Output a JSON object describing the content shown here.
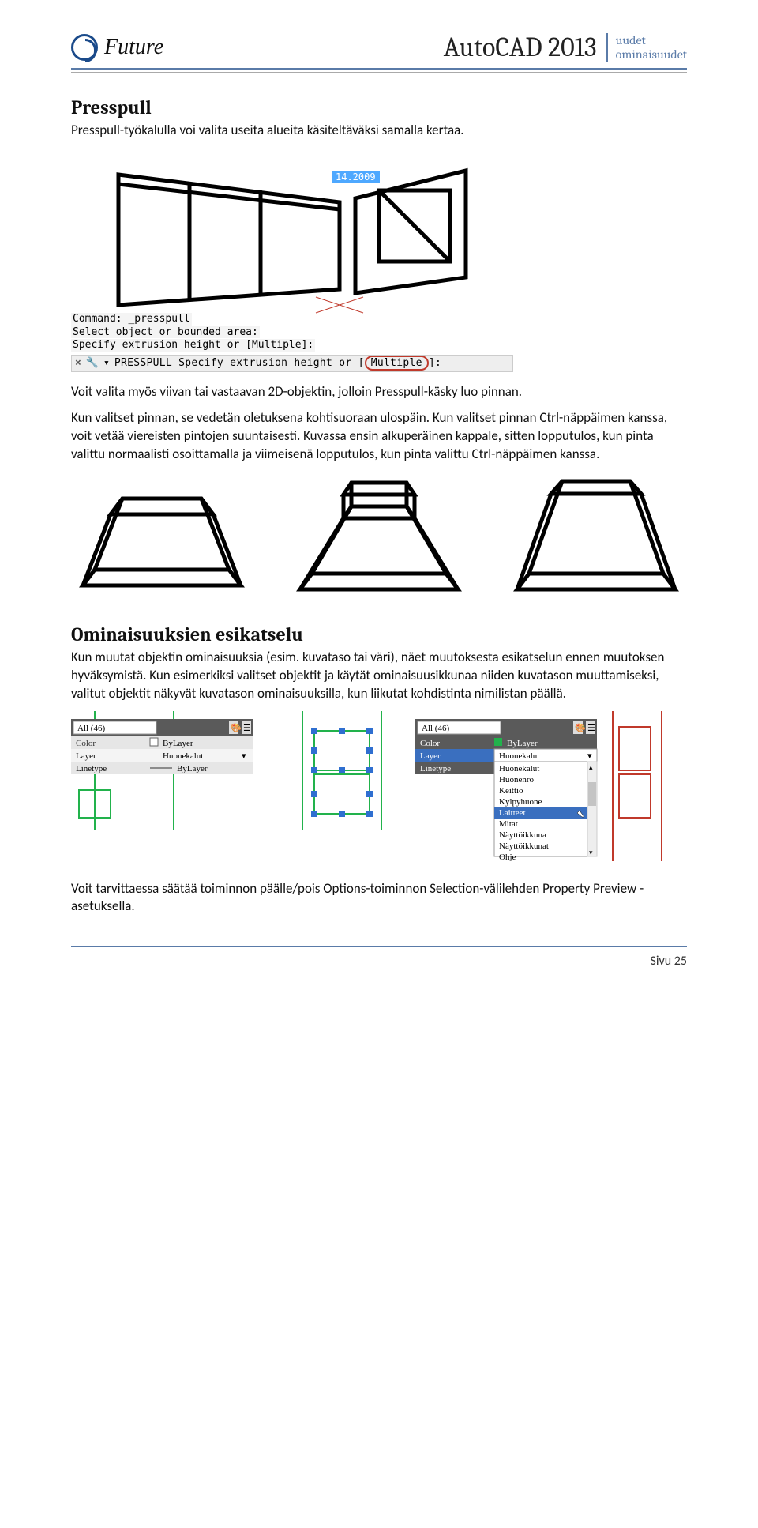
{
  "header": {
    "logo_text": "Future",
    "title_main": "AutoCAD 2013",
    "title_side_line1": "uudet",
    "title_side_line2": "ominaisuudet"
  },
  "section1": {
    "heading": "Presspull",
    "p1": "Presspull-työkalulla voi valita useita alueita käsiteltäväksi samalla kertaa."
  },
  "fig1": {
    "dim": "14.2009",
    "cmd_line1": "Command: _presspull",
    "cmd_line2": "Select object or bounded area:",
    "cmd_line3": "Specify extrusion height or [Multiple]:",
    "bar_label": "PRESSPULL Specify extrusion height or [",
    "bar_opt": "Multiple",
    "bar_end": "]:"
  },
  "section1b": {
    "p2": "Voit valita myös viivan tai vastaavan 2D-objektin, jolloin Presspull-käsky luo pinnan.",
    "p3": "Kun valitset pinnan, se vedetän oletuksena kohtisuoraan ulospäin. Kun valitset pinnan Ctrl-näppäimen kanssa, voit vetää viereisten pintojen suuntaisesti. Kuvassa ensin alkuperäinen kappale, sitten lopputulos, kun pinta valittu normaalisti osoittamalla ja viimeisenä lopputulos, kun pinta valittu Ctrl-näppäimen kanssa."
  },
  "section2": {
    "heading": "Ominaisuuksien esikatselu",
    "p1": "Kun muutat objektin ominaisuuksia (esim. kuvataso tai väri), näet muutoksesta esikatselun ennen muutoksen hyväksymistä. Kun esimerkiksi valitset objektit ja käytät ominaisuusikkunaa niiden kuvatason muuttamiseksi, valitut objektit näkyvät kuvatason ominaisuuksilla, kun liikutat kohdistinta nimilistan päällä."
  },
  "panel_a": {
    "title": "All (46)",
    "rows": [
      {
        "label": "Color",
        "value": "ByLayer"
      },
      {
        "label": "Layer",
        "value": "Huonekalut"
      },
      {
        "label": "Linetype",
        "value": "ByLayer"
      }
    ]
  },
  "panel_b": {
    "title": "All (46)",
    "rows": [
      {
        "label": "Color",
        "value": "ByLayer"
      },
      {
        "label": "Layer",
        "value": "Huonekalut"
      },
      {
        "label": "Linetype",
        "value": ""
      }
    ],
    "dropdown": [
      "Huonekalut",
      "Huonenro",
      "Keittiö",
      "Kylpyhuone",
      "Laitteet",
      "Mitat",
      "Näyttöikkuna",
      "Näyttöikkunat",
      "Ohje"
    ],
    "selected": "Laitteet"
  },
  "section2b": {
    "p2": "Voit tarvittaessa säätää toiminnon päälle/pois Options-toiminnon Selection-välilehden Property Preview -asetuksella."
  },
  "footer": {
    "page": "Sivu 25"
  }
}
